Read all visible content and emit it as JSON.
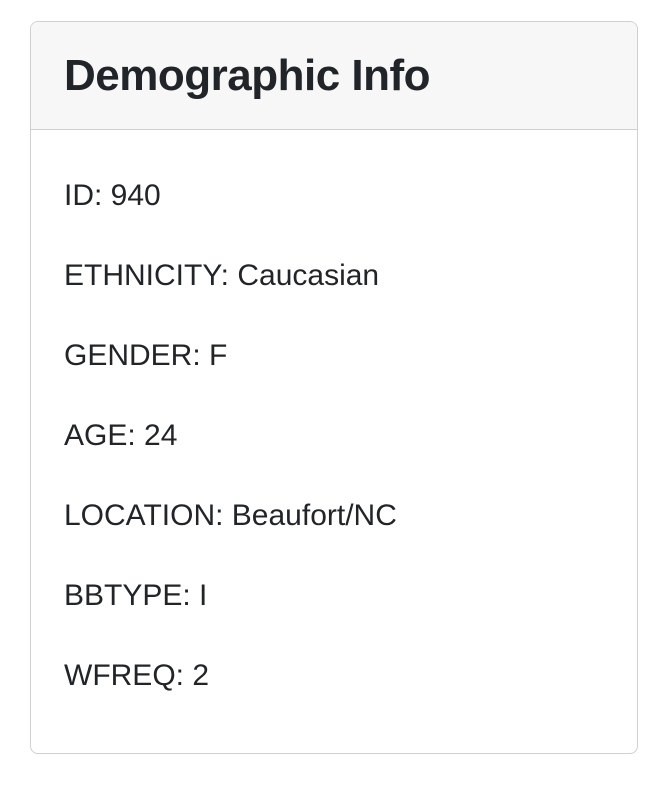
{
  "panel": {
    "title": "Demographic Info",
    "lines": [
      "ID: 940",
      "ETHNICITY: Caucasian",
      "GENDER: F",
      "AGE: 24",
      "LOCATION: Beaufort/NC",
      "BBTYPE: I",
      "WFREQ: 2"
    ]
  }
}
